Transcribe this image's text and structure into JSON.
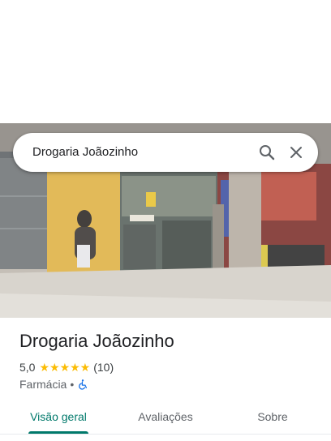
{
  "search": {
    "query": "Drogaria Joãozinho",
    "search_icon": "search-icon",
    "close_icon": "close-icon"
  },
  "place": {
    "name": "Drogaria Joãozinho",
    "rating": "5,0",
    "stars": "★★★★★",
    "stars_value": 5,
    "review_count": "(10)",
    "category": "Farmácia",
    "separator": "•",
    "accessibility_icon": "wheelchair-icon"
  },
  "tabs": [
    {
      "label": "Visão geral",
      "active": true
    },
    {
      "label": "Avaliações",
      "active": false
    },
    {
      "label": "Sobre",
      "active": false
    }
  ],
  "colors": {
    "accent": "#00796b",
    "star": "#fbbc04",
    "access_blue": "#1a73e8"
  }
}
